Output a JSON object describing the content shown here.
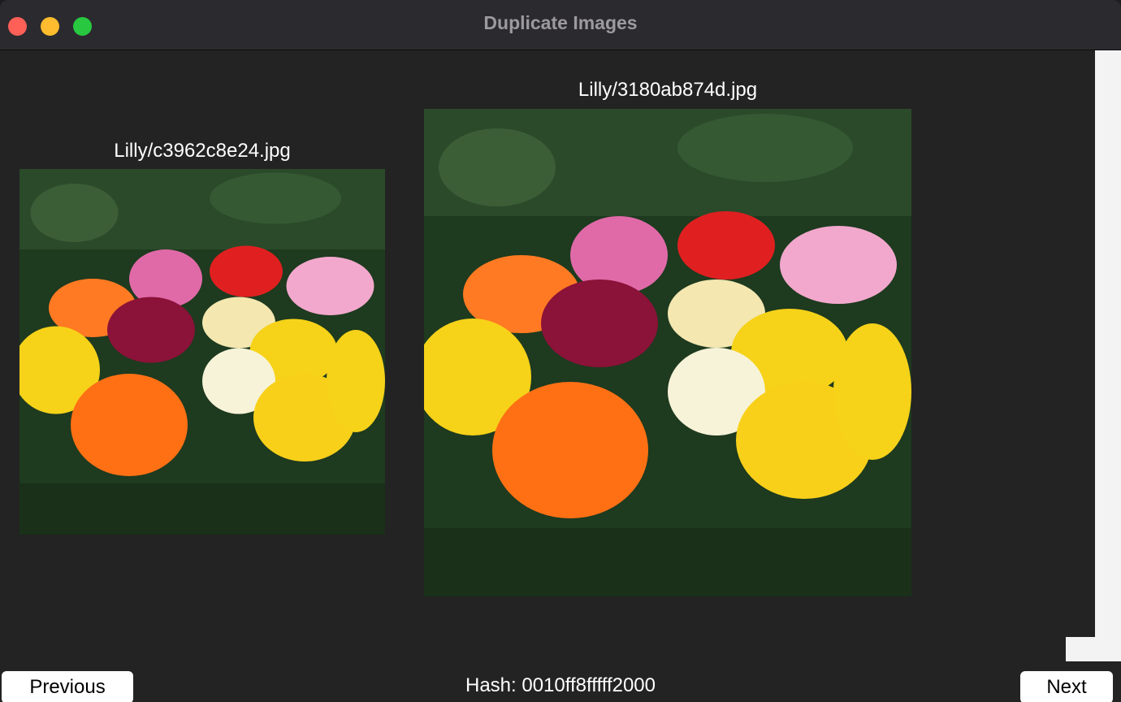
{
  "window": {
    "title": "Duplicate Images"
  },
  "images": [
    {
      "caption": "Lilly/c3962c8e24.jpg",
      "description": "photo-of-lily-flowers"
    },
    {
      "caption": "Lilly/3180ab874d.jpg",
      "description": "photo-of-lily-flowers"
    }
  ],
  "footer": {
    "previous_label": "Previous",
    "hash_text": "Hash: 0010ff8fffff2000",
    "next_label": "Next"
  },
  "colors": {
    "close": "#fe5f57",
    "minimize": "#febc2e",
    "maximize": "#28c840",
    "background": "#232323"
  }
}
